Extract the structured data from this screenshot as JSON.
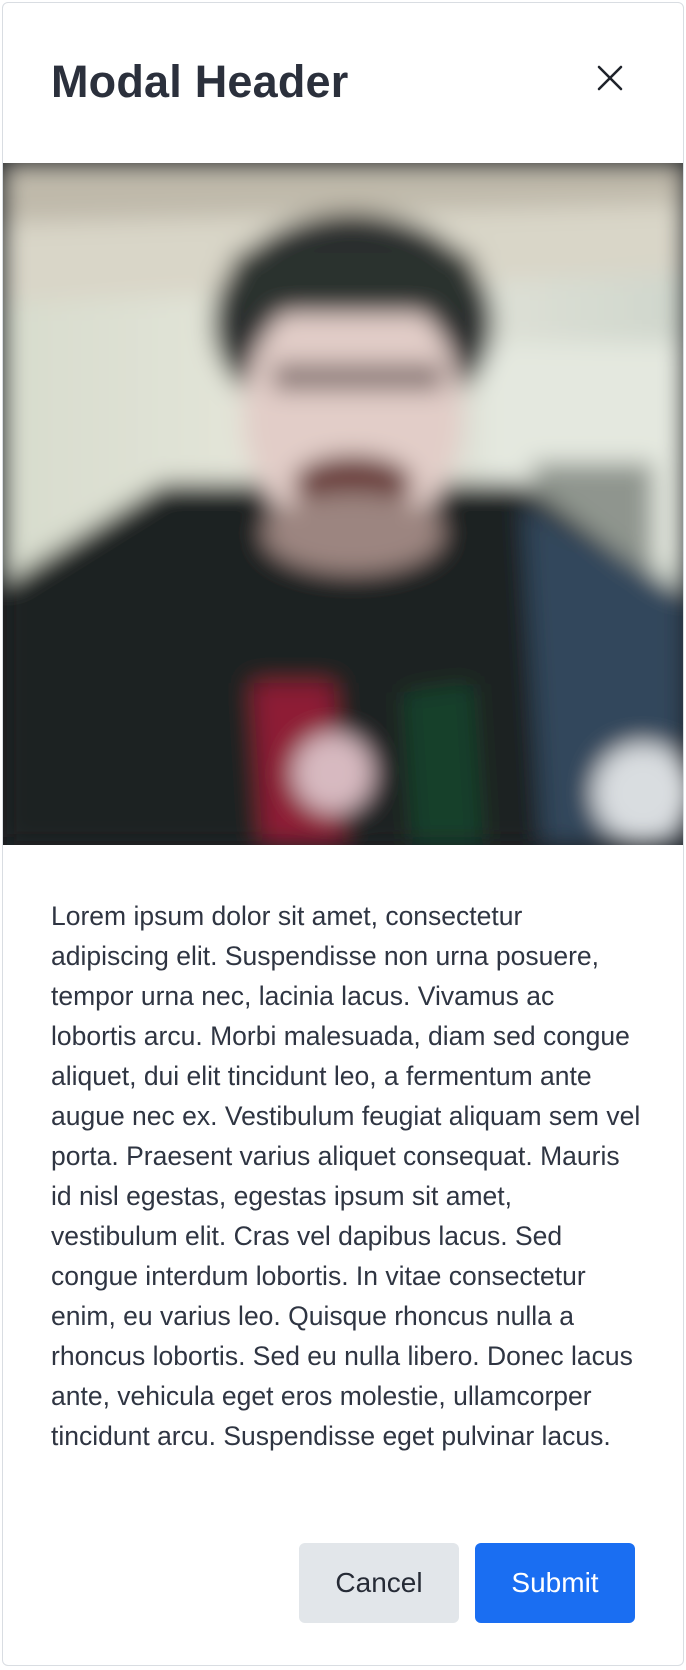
{
  "modal": {
    "title": "Modal Header",
    "close_icon": "close-icon",
    "image": {
      "description_icon": "photo",
      "palette": {
        "background_light": "#dfe3d6",
        "ceiling": "#c9c6bb",
        "hat": "#2a2e2c",
        "skin": "#e3cfc9",
        "beard": "#6c4a46",
        "jacket": "#1c2024",
        "jacket_blue": "#34475e",
        "shirt_red": "#8e1f35"
      }
    },
    "body_text": "Lorem ipsum dolor sit amet, consectetur adipiscing elit. Suspendisse non urna posuere, tempor urna nec, lacinia lacus. Vivamus ac lobortis arcu. Morbi malesuada, diam sed congue aliquet, dui elit tincidunt leo, a fermentum ante augue nec ex. Vestibulum feugiat aliquam sem vel porta. Praesent varius aliquet consequat. Mauris id nisl egestas, egestas ipsum sit amet, vestibulum elit. Cras vel dapibus lacus. Sed congue interdum lobortis. In vitae consectetur enim, eu varius leo. Quisque rhoncus nulla a rhoncus lobortis. Sed eu nulla libero. Donec lacus ante, vehicula eget eros molestie, ullamcorper tincidunt arcu. Suspendisse eget pulvinar lacus.",
    "buttons": {
      "cancel": "Cancel",
      "submit": "Submit"
    },
    "colors": {
      "submit_bg": "#1a6ef2",
      "cancel_bg": "#e2e6ea",
      "text": "#2d3340"
    }
  }
}
